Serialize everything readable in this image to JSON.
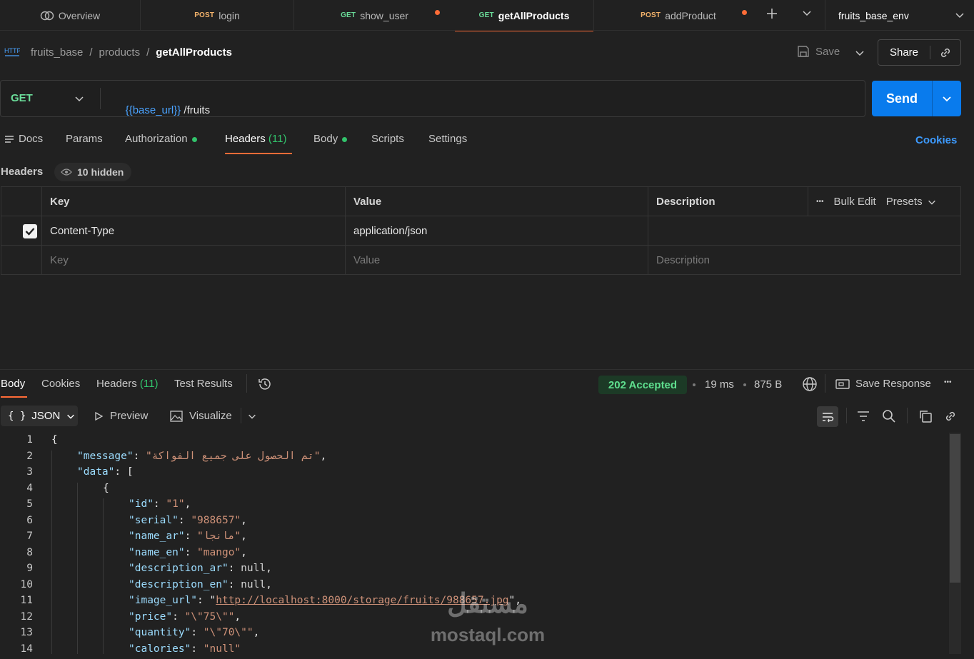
{
  "tabs": [
    {
      "method": "",
      "label": "Overview",
      "modified": false
    },
    {
      "method": "POST",
      "label": "login",
      "modified": false
    },
    {
      "method": "GET",
      "label": "show_user",
      "modified": true
    },
    {
      "method": "GET",
      "label": "getAllProducts",
      "modified": false,
      "active": true
    },
    {
      "method": "POST",
      "label": "addProduct",
      "modified": true
    }
  ],
  "environment": "fruits_base_env",
  "breadcrumb": {
    "collection": "fruits_base",
    "sep1": "/",
    "folder": "products",
    "sep2": "/",
    "request": "getAllProducts"
  },
  "toolbar": {
    "save_label": "Save",
    "share_label": "Share"
  },
  "request": {
    "method": "GET",
    "url_variable": "{{base_url}}",
    "url_path": " /fruits",
    "send_label": "Send"
  },
  "request_tabs": {
    "docs": "Docs",
    "params": "Params",
    "authorization": "Authorization",
    "headers": "Headers",
    "headers_count": "(11)",
    "body": "Body",
    "scripts": "Scripts",
    "settings": "Settings",
    "cookies": "Cookies"
  },
  "headers_section": {
    "title": "Headers",
    "hidden_label": "10 hidden",
    "columns": {
      "key": "Key",
      "value": "Value",
      "description": "Description"
    },
    "more": "•••",
    "bulk_edit": "Bulk Edit",
    "presets": "Presets",
    "rows": [
      {
        "key": "Content-Type",
        "value": "application/json",
        "checked": true
      }
    ],
    "placeholders": {
      "key": "Key",
      "value": "Value",
      "description": "Description"
    }
  },
  "response": {
    "tabs": {
      "body": "Body",
      "cookies": "Cookies",
      "headers": "Headers",
      "headers_count": "(11)",
      "test_results": "Test Results"
    },
    "status": "202 Accepted",
    "time": "19 ms",
    "size": "875 B",
    "save_response": "Save Response",
    "more": "•••",
    "format": "JSON",
    "format_icon": "{ }",
    "preview": "Preview",
    "visualize": "Visualize"
  },
  "code_lines": [
    {
      "n": "1",
      "parts": [
        {
          "t": "{",
          "c": "p"
        }
      ],
      "indent": 0
    },
    {
      "n": "2",
      "parts": [
        {
          "t": "\"message\"",
          "c": "k"
        },
        {
          "t": ": ",
          "c": "p"
        },
        {
          "t": "\"تم الحصول على جميع الفواكة\"",
          "c": "s"
        },
        {
          "t": ",",
          "c": "p"
        }
      ],
      "indent": 1
    },
    {
      "n": "3",
      "parts": [
        {
          "t": "\"data\"",
          "c": "k"
        },
        {
          "t": ": [",
          "c": "p"
        }
      ],
      "indent": 1
    },
    {
      "n": "4",
      "parts": [
        {
          "t": "{",
          "c": "p"
        }
      ],
      "indent": 2
    },
    {
      "n": "5",
      "parts": [
        {
          "t": "\"id\"",
          "c": "k"
        },
        {
          "t": ": ",
          "c": "p"
        },
        {
          "t": "\"1\"",
          "c": "s"
        },
        {
          "t": ",",
          "c": "p"
        }
      ],
      "indent": 3
    },
    {
      "n": "6",
      "parts": [
        {
          "t": "\"serial\"",
          "c": "k"
        },
        {
          "t": ": ",
          "c": "p"
        },
        {
          "t": "\"988657\"",
          "c": "s"
        },
        {
          "t": ",",
          "c": "p"
        }
      ],
      "indent": 3
    },
    {
      "n": "7",
      "parts": [
        {
          "t": "\"name_ar\"",
          "c": "k"
        },
        {
          "t": ": ",
          "c": "p"
        },
        {
          "t": "\"مانجا\"",
          "c": "s"
        },
        {
          "t": ",",
          "c": "p"
        }
      ],
      "indent": 3
    },
    {
      "n": "8",
      "parts": [
        {
          "t": "\"name_en\"",
          "c": "k"
        },
        {
          "t": ": ",
          "c": "p"
        },
        {
          "t": "\"mango\"",
          "c": "s"
        },
        {
          "t": ",",
          "c": "p"
        }
      ],
      "indent": 3
    },
    {
      "n": "9",
      "parts": [
        {
          "t": "\"description_ar\"",
          "c": "k"
        },
        {
          "t": ": ",
          "c": "p"
        },
        {
          "t": "null",
          "c": "n"
        },
        {
          "t": ",",
          "c": "p"
        }
      ],
      "indent": 3
    },
    {
      "n": "10",
      "parts": [
        {
          "t": "\"description_en\"",
          "c": "k"
        },
        {
          "t": ": ",
          "c": "p"
        },
        {
          "t": "null",
          "c": "n"
        },
        {
          "t": ",",
          "c": "p"
        }
      ],
      "indent": 3
    },
    {
      "n": "11",
      "parts": [
        {
          "t": "\"image_url\"",
          "c": "k"
        },
        {
          "t": ": \"",
          "c": "p"
        },
        {
          "t": "http://localhost:8000/storage/fruits/988657.jpg",
          "c": "u"
        },
        {
          "t": "\",",
          "c": "p"
        }
      ],
      "indent": 3
    },
    {
      "n": "12",
      "parts": [
        {
          "t": "\"price\"",
          "c": "k"
        },
        {
          "t": ": ",
          "c": "p"
        },
        {
          "t": "\"\\\"75\\\"\"",
          "c": "s"
        },
        {
          "t": ",",
          "c": "p"
        }
      ],
      "indent": 3
    },
    {
      "n": "13",
      "parts": [
        {
          "t": "\"quantity\"",
          "c": "k"
        },
        {
          "t": ": ",
          "c": "p"
        },
        {
          "t": "\"\\\"70\\\"\"",
          "c": "s"
        },
        {
          "t": ",",
          "c": "p"
        }
      ],
      "indent": 3
    },
    {
      "n": "14",
      "parts": [
        {
          "t": "\"calories\"",
          "c": "k"
        },
        {
          "t": ": ",
          "c": "p"
        },
        {
          "t": "\"null\"",
          "c": "s"
        }
      ],
      "indent": 3
    }
  ],
  "watermark": {
    "arabic": "مستقل",
    "latin": "mostaql.com"
  },
  "colors": {
    "accent_orange": "#ff6c37",
    "send_blue": "#097bed",
    "status_green": "#32c26b",
    "link_blue": "#3d9bff"
  }
}
